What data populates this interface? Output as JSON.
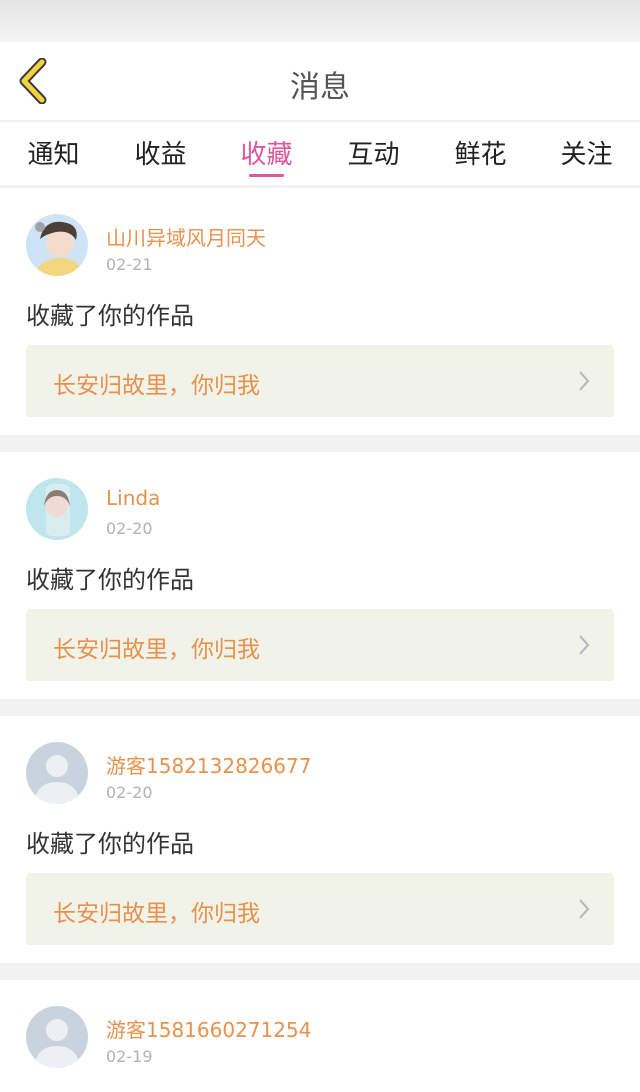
{
  "header": {
    "title": "消息"
  },
  "tabs": [
    {
      "label": "通知"
    },
    {
      "label": "收益"
    },
    {
      "label": "收藏"
    },
    {
      "label": "互动"
    },
    {
      "label": "鲜花"
    },
    {
      "label": "关注"
    }
  ],
  "active_tab": "收藏",
  "messages": [
    {
      "user": "山川异域风月同天",
      "date": "02-21",
      "text": "收藏了你的作品",
      "work": "长安归故里，你归我"
    },
    {
      "user": "Linda",
      "date": "02-20",
      "text": "收藏了你的作品",
      "work": "长安归故里，你归我"
    },
    {
      "user": "游客1582132826677",
      "date": "02-20",
      "text": "收藏了你的作品",
      "work": "长安归故里，你归我"
    },
    {
      "user": "游客1581660271254",
      "date": "02-19"
    }
  ],
  "colors": {
    "accent": "#e0579a",
    "name": "#e8914d",
    "back_icon": "#f3d43f"
  },
  "icons": {
    "back": "chevron-left-icon",
    "open_work": "chevron-right-icon"
  }
}
